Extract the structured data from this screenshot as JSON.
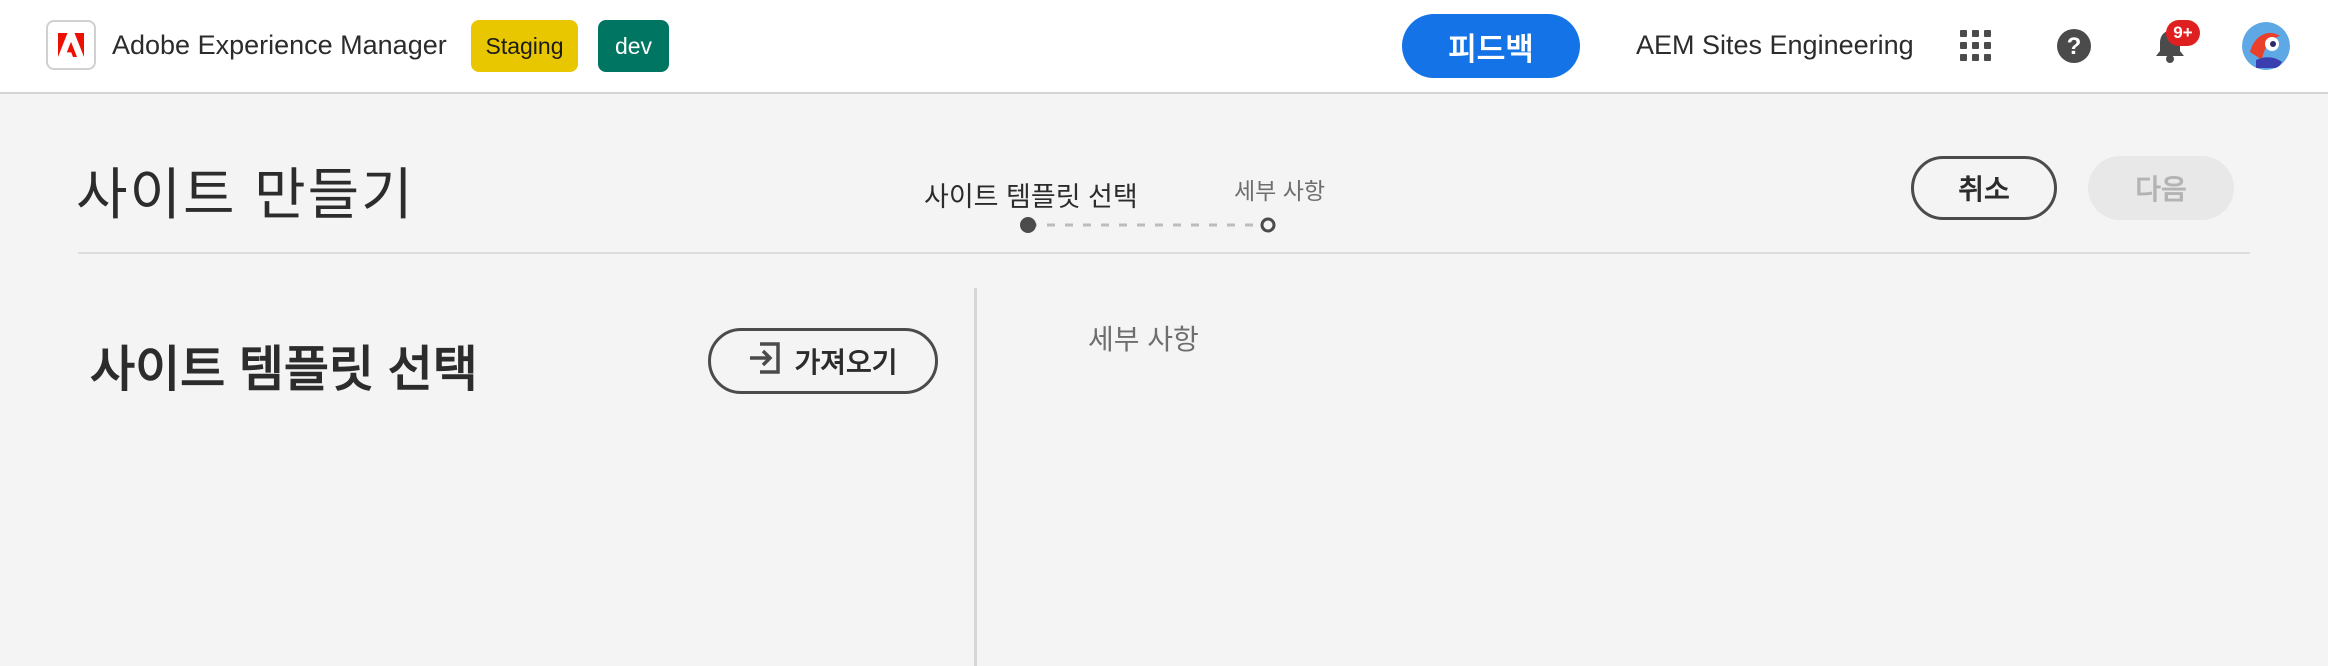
{
  "topbar": {
    "app_name": "Adobe Experience Manager",
    "badges": {
      "staging": "Staging",
      "dev": "dev"
    },
    "feedback_label": "피드백",
    "org_name": "AEM Sites Engineering",
    "notification_count": "9+",
    "icons": [
      "adobe-logo-icon",
      "apps-grid-icon",
      "help-icon",
      "bell-icon",
      "avatar"
    ]
  },
  "wizard": {
    "title": "사이트 만들기",
    "steps": [
      {
        "label": "사이트 템플릿 선택",
        "state": "current"
      },
      {
        "label": "세부 사항",
        "state": "upcoming"
      }
    ],
    "cancel_label": "취소",
    "next_label": "다음"
  },
  "left_panel": {
    "heading": "사이트 템플릿 선택",
    "import_label": "가져오기"
  },
  "right_panel": {
    "heading": "세부 사항"
  },
  "colors": {
    "accent": "#1473e6",
    "staging": "#e8c600",
    "dev": "#007562",
    "adobe_red": "#eb1000",
    "notification": "#e02020"
  }
}
